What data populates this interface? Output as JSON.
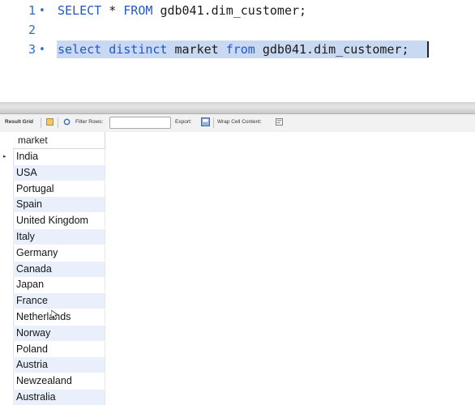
{
  "editor": {
    "lines": [
      {
        "num": "1",
        "dot": "•",
        "text": "SELECT * FROM gdb041.dim_customer;"
      },
      {
        "num": "2",
        "dot": "",
        "text": ""
      },
      {
        "num": "3",
        "dot": "•",
        "text": "select distinct market from gdb041.dim_customer;"
      }
    ]
  },
  "toolbar": {
    "result_grid": "Result Grid",
    "filter_rows": "Filter Rows:",
    "filter_value": "",
    "export": "Export:",
    "wrap_cell": "Wrap Cell Content:"
  },
  "grid": {
    "column": "market",
    "active_row_marker": "▸",
    "rows": [
      "India",
      "USA",
      "Portugal",
      "Spain",
      "United Kingdom",
      "Italy",
      "Germany",
      "Canada",
      "Japan",
      "France",
      "Netherlands",
      "Norway",
      "Poland",
      "Austria",
      "Newzealand",
      "Australia"
    ]
  },
  "colors": {
    "keyword": "#2157c9",
    "selection": "#c9d9f2",
    "alt_row": "#e9f0fb"
  }
}
